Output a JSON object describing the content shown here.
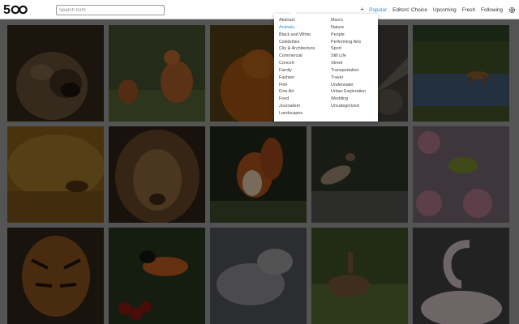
{
  "header": {
    "logo_text": "500px",
    "search_placeholder": "Search form",
    "add_symbol": "+",
    "tabs": [
      {
        "label": "Popular",
        "active": true
      },
      {
        "label": "Editors' Choice",
        "active": false
      },
      {
        "label": "Upcoming",
        "active": false
      },
      {
        "label": "Fresh",
        "active": false
      },
      {
        "label": "Following",
        "active": false
      }
    ],
    "settings_icon": "gear-icon"
  },
  "categories": {
    "selected": "Animals",
    "column1": [
      "Abstract",
      "Animals",
      "Black and White",
      "Celebrities",
      "City & Architecture",
      "Commercial",
      "Concert",
      "Family",
      "Fashion",
      "Film",
      "Fine Art",
      "Food",
      "Journalism",
      "Landscapes"
    ],
    "column2": [
      "Macro",
      "Nature",
      "People",
      "Performing Arts",
      "Sport",
      "Still Life",
      "Street",
      "Transportation",
      "Travel",
      "Underwater",
      "Urban Exploration",
      "Wedding",
      "Uncategorized"
    ]
  },
  "photos": [
    {
      "subject": "roaring lioness"
    },
    {
      "subject": "two foxes"
    },
    {
      "subject": "orange monkey"
    },
    {
      "subject": "bird on branch"
    },
    {
      "subject": "deer at lake"
    },
    {
      "subject": "deer in autumn forest"
    },
    {
      "subject": "lion portrait"
    },
    {
      "subject": "red squirrel"
    },
    {
      "subject": "heron"
    },
    {
      "subject": "bird in blossoms"
    },
    {
      "subject": "tiger"
    },
    {
      "subject": "oriole on berries"
    },
    {
      "subject": "grey cat"
    },
    {
      "subject": "hare in grass"
    },
    {
      "subject": "flamingo"
    }
  ],
  "colors": {
    "accent": "#2a8fd4",
    "page_background": "#8c8c8c"
  }
}
